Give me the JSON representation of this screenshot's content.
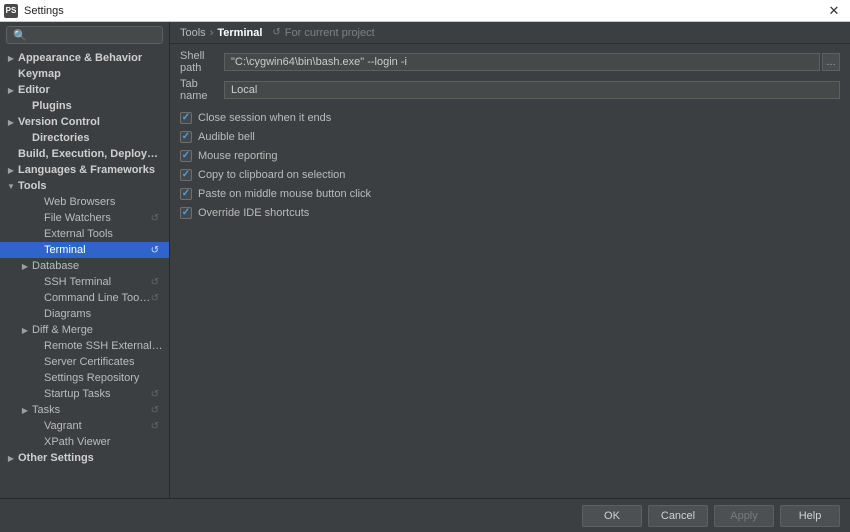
{
  "window": {
    "title": "Settings",
    "app_icon_text": "PS"
  },
  "search": {
    "placeholder": ""
  },
  "tree": [
    {
      "label": "Appearance & Behavior",
      "depth": 1,
      "bold": true,
      "expandable": true,
      "expanded": false
    },
    {
      "label": "Keymap",
      "depth": 1,
      "bold": true
    },
    {
      "label": "Editor",
      "depth": 1,
      "bold": true,
      "expandable": true,
      "expanded": false
    },
    {
      "label": "Plugins",
      "depth": 2,
      "bold": true
    },
    {
      "label": "Version Control",
      "depth": 1,
      "bold": true,
      "expandable": true,
      "expanded": false
    },
    {
      "label": "Directories",
      "depth": 2,
      "bold": true
    },
    {
      "label": "Build, Execution, Deployment",
      "depth": 1,
      "bold": true
    },
    {
      "label": "Languages & Frameworks",
      "depth": 1,
      "bold": true,
      "expandable": true,
      "expanded": false
    },
    {
      "label": "Tools",
      "depth": 1,
      "bold": true,
      "expandable": true,
      "expanded": true
    },
    {
      "label": "Web Browsers",
      "depth": 3
    },
    {
      "label": "File Watchers",
      "depth": 3,
      "restart": true
    },
    {
      "label": "External Tools",
      "depth": 3
    },
    {
      "label": "Terminal",
      "depth": 3,
      "restart": true,
      "selected": true
    },
    {
      "label": "Database",
      "depth": 3,
      "expandable": true,
      "expanded": false,
      "depthArrow": 2
    },
    {
      "label": "SSH Terminal",
      "depth": 3,
      "restart": true
    },
    {
      "label": "Command Line Tool Support",
      "depth": 3,
      "restart": true
    },
    {
      "label": "Diagrams",
      "depth": 3
    },
    {
      "label": "Diff & Merge",
      "depth": 3,
      "expandable": true,
      "expanded": false,
      "depthArrow": 2
    },
    {
      "label": "Remote SSH External Tools",
      "depth": 3
    },
    {
      "label": "Server Certificates",
      "depth": 3
    },
    {
      "label": "Settings Repository",
      "depth": 3
    },
    {
      "label": "Startup Tasks",
      "depth": 3,
      "restart": true
    },
    {
      "label": "Tasks",
      "depth": 3,
      "expandable": true,
      "expanded": false,
      "depthArrow": 2,
      "restart": true
    },
    {
      "label": "Vagrant",
      "depth": 3,
      "restart": true
    },
    {
      "label": "XPath Viewer",
      "depth": 3
    },
    {
      "label": "Other Settings",
      "depth": 1,
      "bold": true,
      "expandable": true,
      "expanded": false
    }
  ],
  "breadcrumb": {
    "root": "Tools",
    "current": "Terminal",
    "project_note": "For current project"
  },
  "fields": {
    "shell_path": {
      "label": "Shell path",
      "value": "\"C:\\cygwin64\\bin\\bash.exe\" --login -i"
    },
    "tab_name": {
      "label": "Tab name",
      "value": "Local"
    }
  },
  "checkboxes": [
    {
      "label": "Close session when it ends",
      "checked": true
    },
    {
      "label": "Audible bell",
      "checked": true
    },
    {
      "label": "Mouse reporting",
      "checked": true
    },
    {
      "label": "Copy to clipboard on selection",
      "checked": true
    },
    {
      "label": "Paste on middle mouse button click",
      "checked": true
    },
    {
      "label": "Override IDE shortcuts",
      "checked": true
    }
  ],
  "buttons": {
    "ok": "OK",
    "cancel": "Cancel",
    "apply": "Apply",
    "help": "Help"
  }
}
